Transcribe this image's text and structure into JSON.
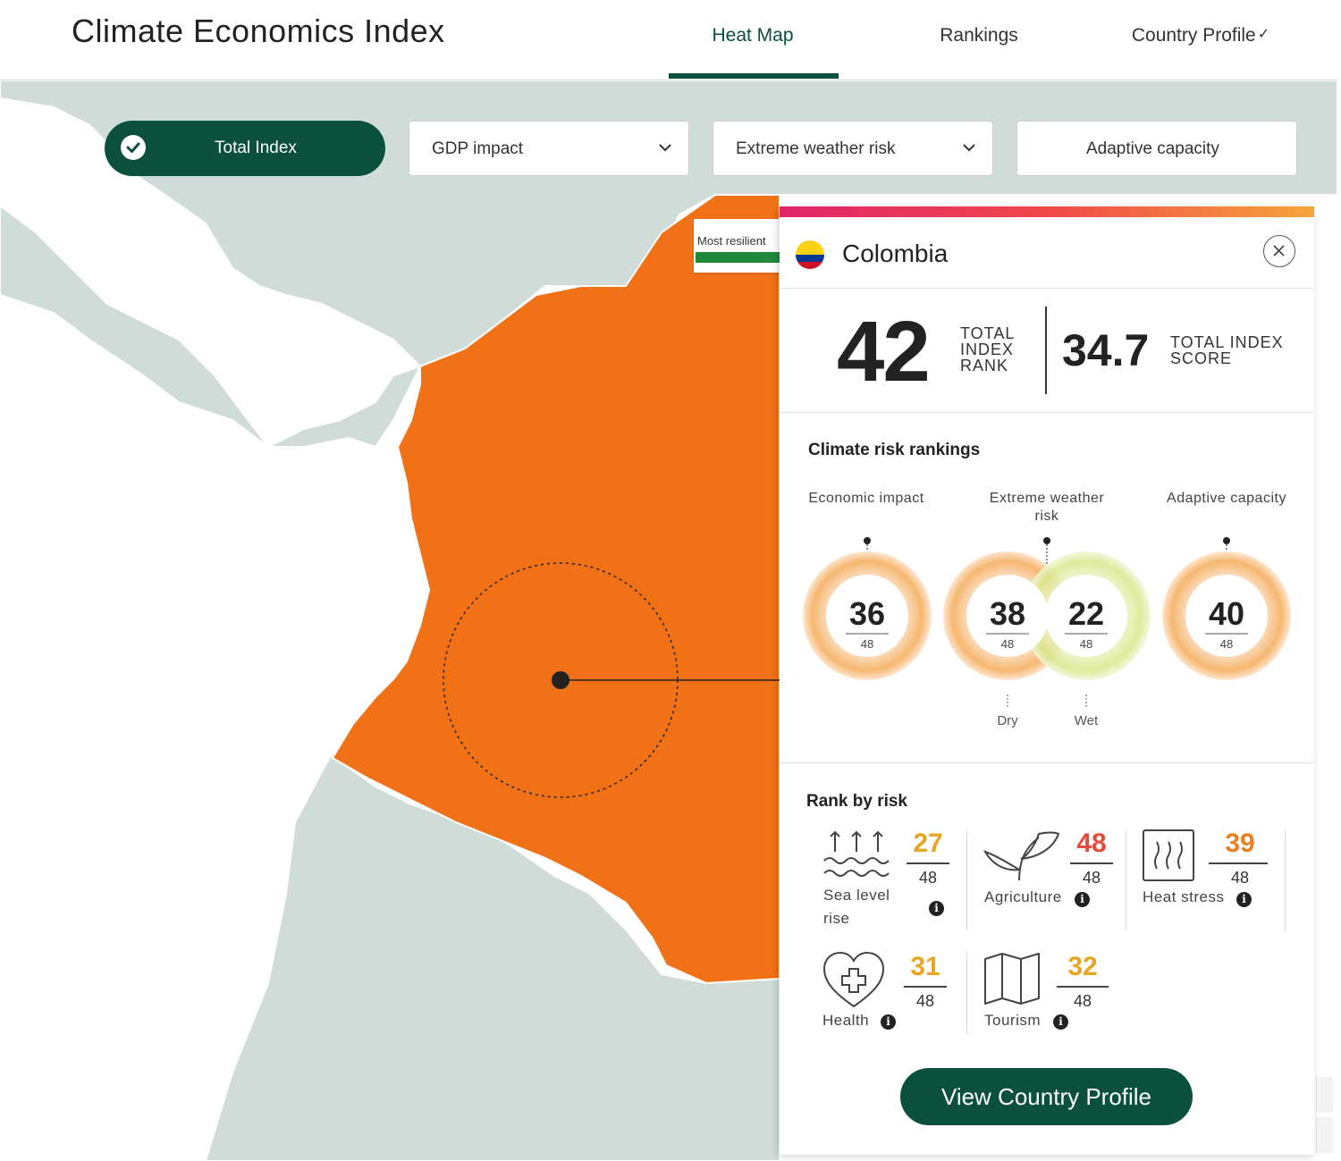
{
  "header": {
    "title": "Climate Economics Index",
    "tabs": [
      {
        "label": "Heat Map",
        "active": true
      },
      {
        "label": "Rankings",
        "active": false
      },
      {
        "label": "Country Profile",
        "active": false
      }
    ]
  },
  "filters": {
    "total_index": "Total Index",
    "gdp_impact": "GDP impact",
    "extreme_weather": "Extreme weather risk",
    "adaptive_capacity": "Adaptive capacity"
  },
  "legend": {
    "label": "Most resilient"
  },
  "colors": {
    "brand": "#0b4f3d",
    "highlight_country": "#f07116",
    "land": "#cfdcd8",
    "risk_orange": "#e8a521",
    "risk_red": "#e84a3a"
  },
  "card": {
    "country": "Colombia",
    "rank": {
      "value": "42",
      "label": "TOTAL INDEX RANK"
    },
    "score": {
      "value": "34.7",
      "label": "TOTAL INDEX SCORE"
    },
    "climate_title": "Climate risk rankings",
    "rings": {
      "economic": {
        "title": "Economic impact",
        "value": "36",
        "total": "48"
      },
      "extreme": {
        "title": "Extreme weather risk",
        "dry": {
          "value": "38",
          "total": "48",
          "label": "Dry"
        },
        "wet": {
          "value": "22",
          "total": "48",
          "label": "Wet"
        }
      },
      "adaptive": {
        "title": "Adaptive capacity",
        "value": "40",
        "total": "48"
      }
    },
    "rank_title": "Rank by risk",
    "risks": [
      {
        "label": "Sea level rise",
        "value": "27",
        "total": "48",
        "color": "#e8a521",
        "icon": "sea-level-icon"
      },
      {
        "label": "Agriculture",
        "value": "48",
        "total": "48",
        "color": "#e84a3a",
        "icon": "agriculture-icon"
      },
      {
        "label": "Heat stress",
        "value": "39",
        "total": "48",
        "color": "#e8801f",
        "icon": "heat-stress-icon"
      },
      {
        "label": "Health",
        "value": "31",
        "total": "48",
        "color": "#e8a521",
        "icon": "health-icon"
      },
      {
        "label": "Tourism",
        "value": "32",
        "total": "48",
        "color": "#e8a521",
        "icon": "tourism-icon"
      }
    ],
    "cta": "View Country Profile"
  }
}
